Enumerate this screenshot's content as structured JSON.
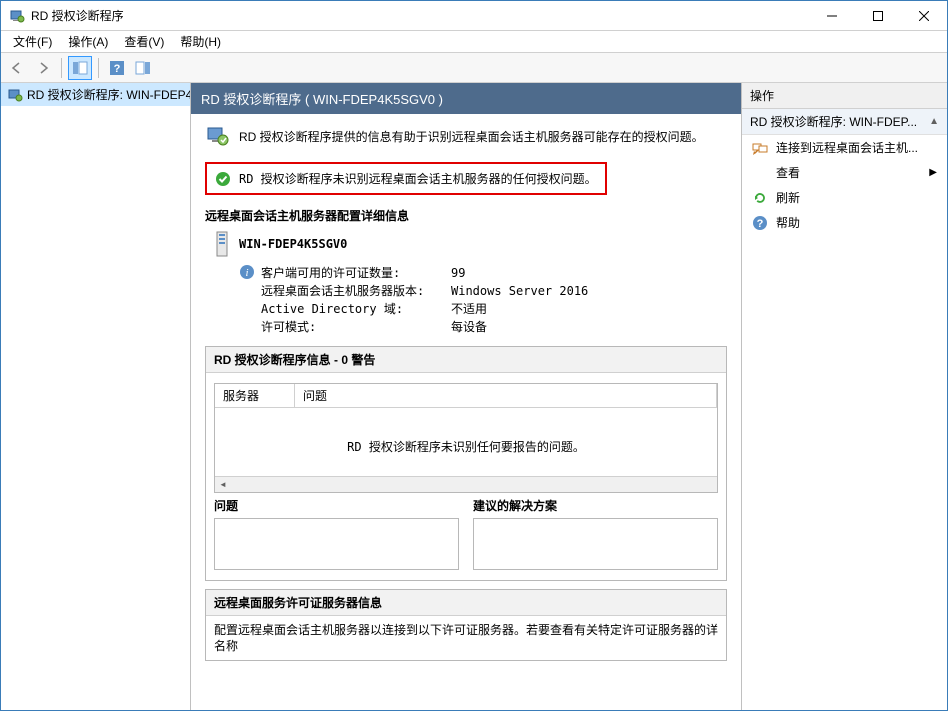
{
  "window": {
    "title": "RD 授权诊断程序"
  },
  "menu": {
    "file": "文件(F)",
    "action": "操作(A)",
    "view": "查看(V)",
    "help": "帮助(H)"
  },
  "tree": {
    "root": "RD 授权诊断程序: WIN-FDEP4"
  },
  "center": {
    "header": "RD 授权诊断程序 ( WIN-FDEP4K5SGV0 )",
    "intro": "RD 授权诊断程序提供的信息有助于识别远程桌面会话主机服务器可能存在的授权问题。",
    "status": "RD 授权诊断程序未识别远程桌面会话主机服务器的任何授权问题。",
    "section_config_title": "远程桌面会话主机服务器配置详细信息",
    "server_name": "WIN-FDEP4K5SGV0",
    "kv": [
      {
        "label": "客户端可用的许可证数量:",
        "value": "99"
      },
      {
        "label": "远程桌面会话主机服务器版本:",
        "value": "Windows Server 2016"
      },
      {
        "label": "Active Directory 域:",
        "value": "不适用"
      },
      {
        "label": "许可模式:",
        "value": "每设备"
      }
    ],
    "diag_group_title": "RD 授权诊断程序信息 - 0 警告",
    "table": {
      "cols": [
        "服务器",
        "问题"
      ],
      "empty_msg": "RD 授权诊断程序未识别任何要报告的问题。"
    },
    "problem_title": "问题",
    "solution_title": "建议的解决方案",
    "license_group_title": "远程桌面服务许可证服务器信息",
    "license_text": "配置远程桌面会话主机服务器以连接到以下许可证服务器。若要查看有关特定许可证服务器的详\n名称"
  },
  "actions": {
    "header": "操作",
    "group_title": "RD 授权诊断程序: WIN-FDEP...",
    "items": {
      "connect": "连接到远程桌面会话主机...",
      "view": "查看",
      "refresh": "刷新",
      "help": "帮助"
    }
  }
}
